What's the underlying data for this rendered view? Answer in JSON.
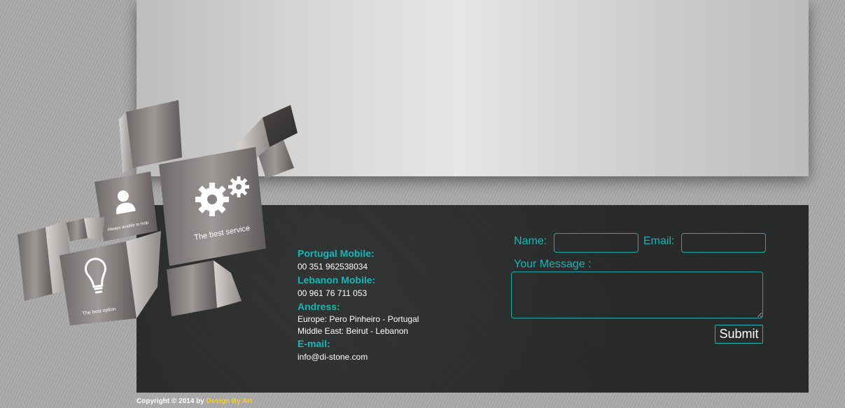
{
  "contact": {
    "portugal_label": "Portugal Mobile:",
    "portugal_value": "00 351 962538034",
    "lebanon_label": "Lebanon Mobile:",
    "lebanon_value": "00 961 76 711 053",
    "address_label": "Andress:",
    "address_europe": "Europe: Pero Pinheiro - Portugal",
    "address_middle_east": "Middle East: Beirut - Lebanon",
    "email_label": "E-mail:",
    "email_value": "info@di-stone.com"
  },
  "form": {
    "name_label": "Name:",
    "email_label": "Email:",
    "message_label": "Your Message :",
    "name_value": "",
    "email_value": "",
    "submit_label": "Submit"
  },
  "cubes": {
    "cube1_text": "The best service",
    "cube2_text": "Always avaible to help",
    "cube3_text": "The best option"
  },
  "footer": {
    "copyright_text": "Copyright © 2014 by",
    "brand_text": "Design By Art"
  },
  "colors": {
    "accent": "#19b5b8",
    "brand": "#f5d020",
    "panel": "#252827"
  }
}
